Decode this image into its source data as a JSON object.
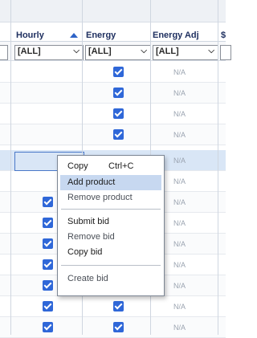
{
  "columns": {
    "hourly": "Hourly",
    "energy": "Energy",
    "energy_adj": "Energy Adj",
    "cut": "$"
  },
  "sort": {
    "column": "Hourly",
    "direction": "ascending"
  },
  "filters": {
    "all_label": "[ALL]",
    "chevron": "❯"
  },
  "na_text": "N/A",
  "context_menu": {
    "copy": "Copy",
    "copy_shortcut": "Ctrl+C",
    "add_product": "Add product",
    "remove_product": "Remove product",
    "submit_bid": "Submit bid",
    "remove_bid": "Remove bid",
    "copy_bid": "Copy bid",
    "create_bid": "Create bid"
  },
  "colors": {
    "accent": "#2f67d8",
    "selection": "#d9e6f6",
    "menu_highlight": "#c7d8f0",
    "na_text": "#9aa3b0",
    "header_text": "#1f3060"
  }
}
